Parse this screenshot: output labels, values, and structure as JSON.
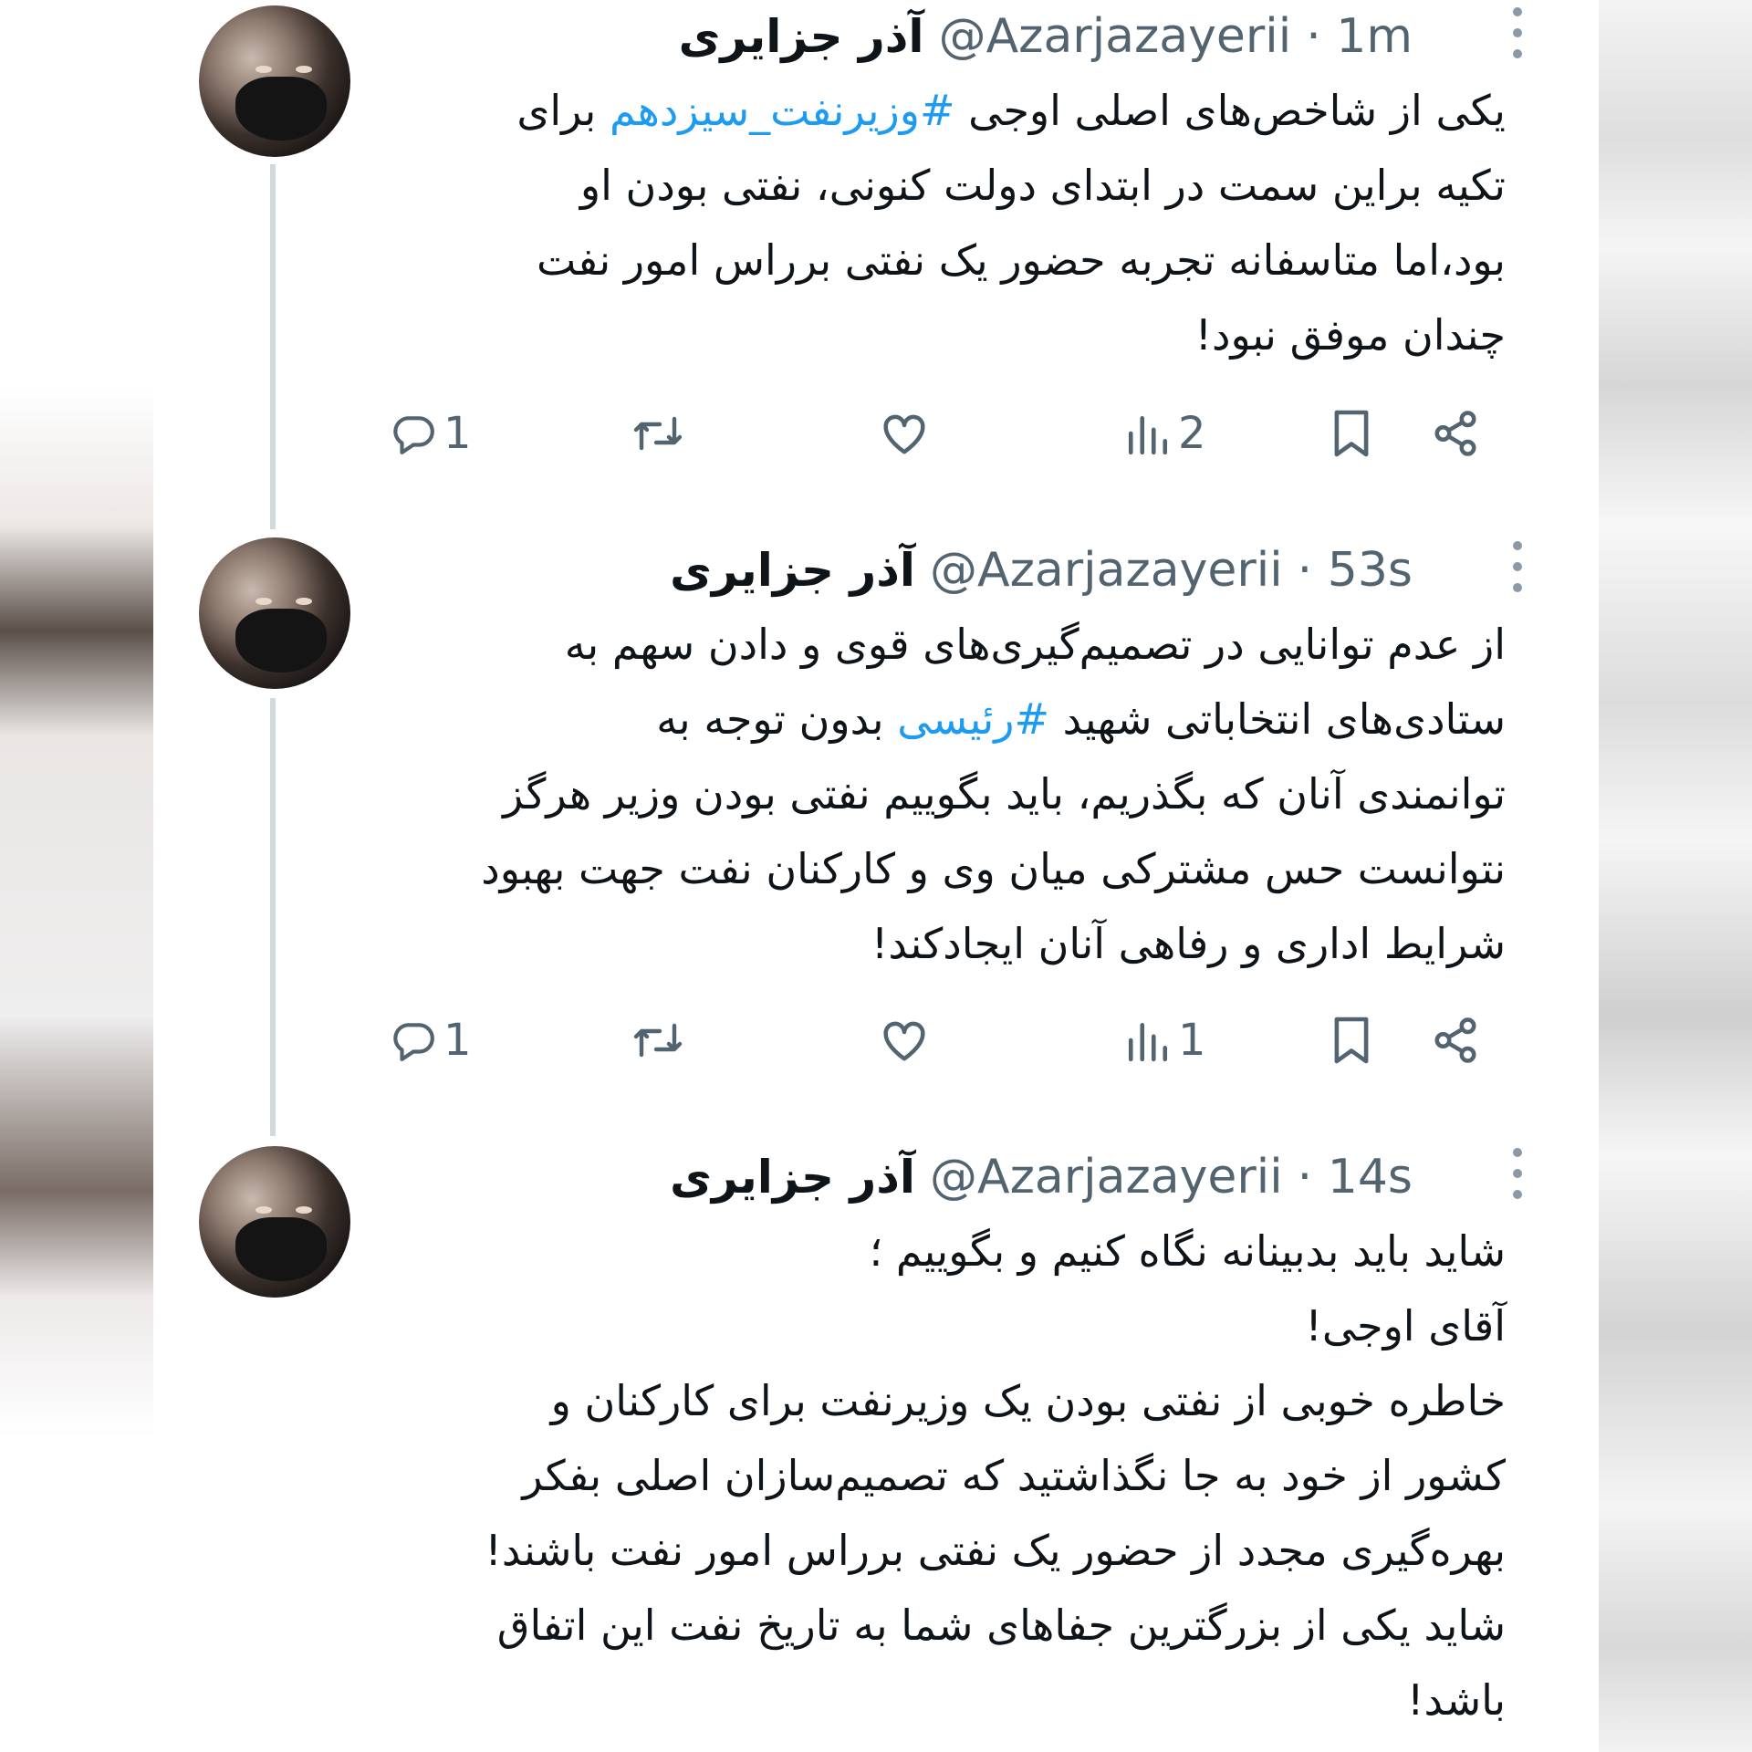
{
  "author": {
    "name": "آذر جزایری",
    "handle": "@Azarjazayerii"
  },
  "tweets": [
    {
      "time": "· 1m",
      "lines": [
        {
          "before": "یکی از شاخص‌های اصلی اوجی ",
          "tag": "#وزیرنفت_سیزدهم",
          "after": " برای"
        },
        {
          "before": "تکیه براین سمت در ابتدای دولت کنونی، نفتی بودن او",
          "tag": "",
          "after": ""
        },
        {
          "before": "بود،اما متاسفانه تجربه حضور یک نفتی برراس امور نفت",
          "tag": "",
          "after": ""
        },
        {
          "before": "چندان موفق نبود!",
          "tag": "",
          "after": ""
        }
      ],
      "replies": "1",
      "views": "2"
    },
    {
      "time": "· 53s",
      "lines": [
        {
          "before": "از عدم توانایی در تصمیم‌گیری‌های قوی و دادن سهم به",
          "tag": "",
          "after": ""
        },
        {
          "before": "ستادی‌های انتخاباتی شهید ",
          "tag": "#رئیسی",
          "after": " بدون توجه به"
        },
        {
          "before": "توانمندی آنان که بگذریم، باید بگوییم نفتی بودن وزیر هرگز",
          "tag": "",
          "after": ""
        },
        {
          "before": "نتوانست حس مشترکی میان وی و کارکنان نفت جهت بهبود",
          "tag": "",
          "after": ""
        },
        {
          "before": "شرایط اداری و رفاهی آنان ایجادکند!",
          "tag": "",
          "after": ""
        }
      ],
      "replies": "1",
      "views": "1"
    },
    {
      "time": "· 14s",
      "lines": [
        {
          "before": "شاید باید بدبینانه نگاه کنیم و بگوییم ؛",
          "tag": "",
          "after": ""
        },
        {
          "before": "آقای اوجی!",
          "tag": "",
          "after": ""
        },
        {
          "before": "خاطره خوبی از نفتی بودن یک وزیرنفت برای کارکنان و",
          "tag": "",
          "after": ""
        },
        {
          "before": "کشور از خود به جا نگذاشتید که تصمیم‌سازان اصلی  بفکر",
          "tag": "",
          "after": ""
        },
        {
          "before": "بهره‌گیری مجدد از حضور یک نفتی برراس امور نفت باشند!",
          "tag": "",
          "after": ""
        },
        {
          "before": "شاید یکی از بزرگترین جفاهای شما به تاریخ نفت این اتفاق",
          "tag": "",
          "after": ""
        },
        {
          "before": "باشد!",
          "tag": "",
          "after": ""
        }
      ]
    }
  ],
  "icons": {
    "reply": "reply-icon",
    "retweet": "retweet-icon",
    "like": "like-icon",
    "views": "views-icon",
    "bookmark": "bookmark-icon",
    "share": "share-icon",
    "more": "more-vertical-icon"
  },
  "colors": {
    "text": "#0f1419",
    "secondary": "#536471",
    "hashtag": "#1d9bf0",
    "thread_line": "#cfd9de"
  }
}
